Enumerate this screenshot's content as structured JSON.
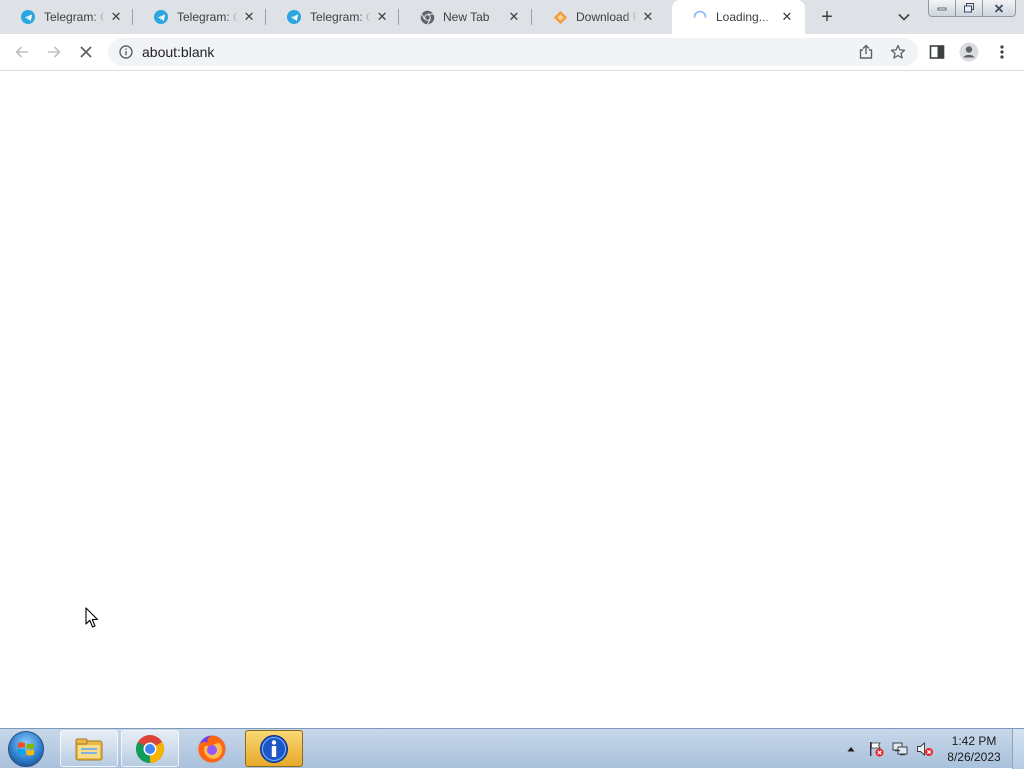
{
  "browser": {
    "tabs": [
      {
        "title": "Telegram: Co",
        "icon": "telegram-icon"
      },
      {
        "title": "Telegram: Co",
        "icon": "telegram-icon"
      },
      {
        "title": "Telegram: Co",
        "icon": "telegram-icon"
      },
      {
        "title": "New Tab",
        "icon": "chrome-icon"
      },
      {
        "title": "Download Pr",
        "icon": "download-site-icon"
      },
      {
        "title": "Loading...",
        "icon": "loading-spinner-icon",
        "active": true
      }
    ],
    "new_tab_label": "+",
    "address": {
      "url": "about:blank"
    }
  },
  "taskbar": {
    "apps": [
      "windows-explorer-icon",
      "chrome-icon",
      "firefox-icon",
      "info-app-icon"
    ],
    "clock": {
      "time": "1:42 PM",
      "date": "8/26/2023"
    }
  },
  "colors": {
    "tabstrip": "#dee1e6",
    "telegram": "#2ca5e0",
    "accent_orange": "#f29a38"
  }
}
